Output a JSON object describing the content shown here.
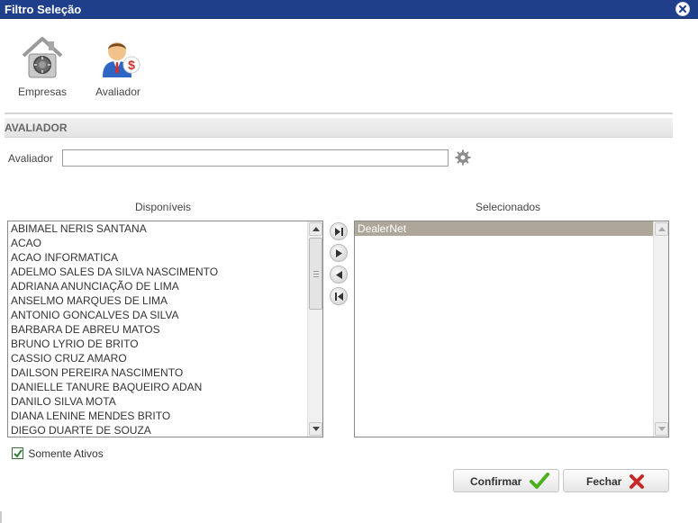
{
  "window": {
    "title": "Filtro Seleção"
  },
  "toolbar": {
    "items": [
      {
        "label": "Empresas",
        "icon": "safe-house-icon"
      },
      {
        "label": "Avaliador",
        "icon": "evaluator-person-icon"
      }
    ]
  },
  "section": {
    "header": "AVALIADOR"
  },
  "filter": {
    "label": "Avaliador",
    "value": ""
  },
  "lists": {
    "available_title": "Disponíveis",
    "selected_title": "Selecionados",
    "available": [
      "ABIMAEL NERIS SANTANA",
      "ACAO",
      "ACAO INFORMATICA",
      "ADELMO SALES DA SILVA NASCIMENTO",
      "ADRIANA ANUNCIAÇÃO DE LIMA",
      "ANSELMO MARQUES DE LIMA",
      "ANTONIO GONCALVES DA SILVA",
      "BARBARA DE ABREU MATOS",
      "BRUNO LYRIO DE BRITO",
      "CASSIO CRUZ AMARO",
      "DAILSON PEREIRA NASCIMENTO",
      "DANIELLE TANURE BAQUEIRO ADAN",
      "DANILO SILVA MOTA",
      "DIANA LENINE MENDES BRITO",
      "DIEGO DUARTE DE SOUZA"
    ],
    "selected": [
      "DealerNet"
    ]
  },
  "options": {
    "only_active_label": "Somente Ativos",
    "only_active_checked": true
  },
  "buttons": {
    "confirm": "Confirmar",
    "close": "Fechar"
  },
  "colors": {
    "titlebar": "#1f3f8a",
    "selected_row": "#aea699",
    "confirm_check": "#4caf1e",
    "close_x": "#c62828"
  }
}
